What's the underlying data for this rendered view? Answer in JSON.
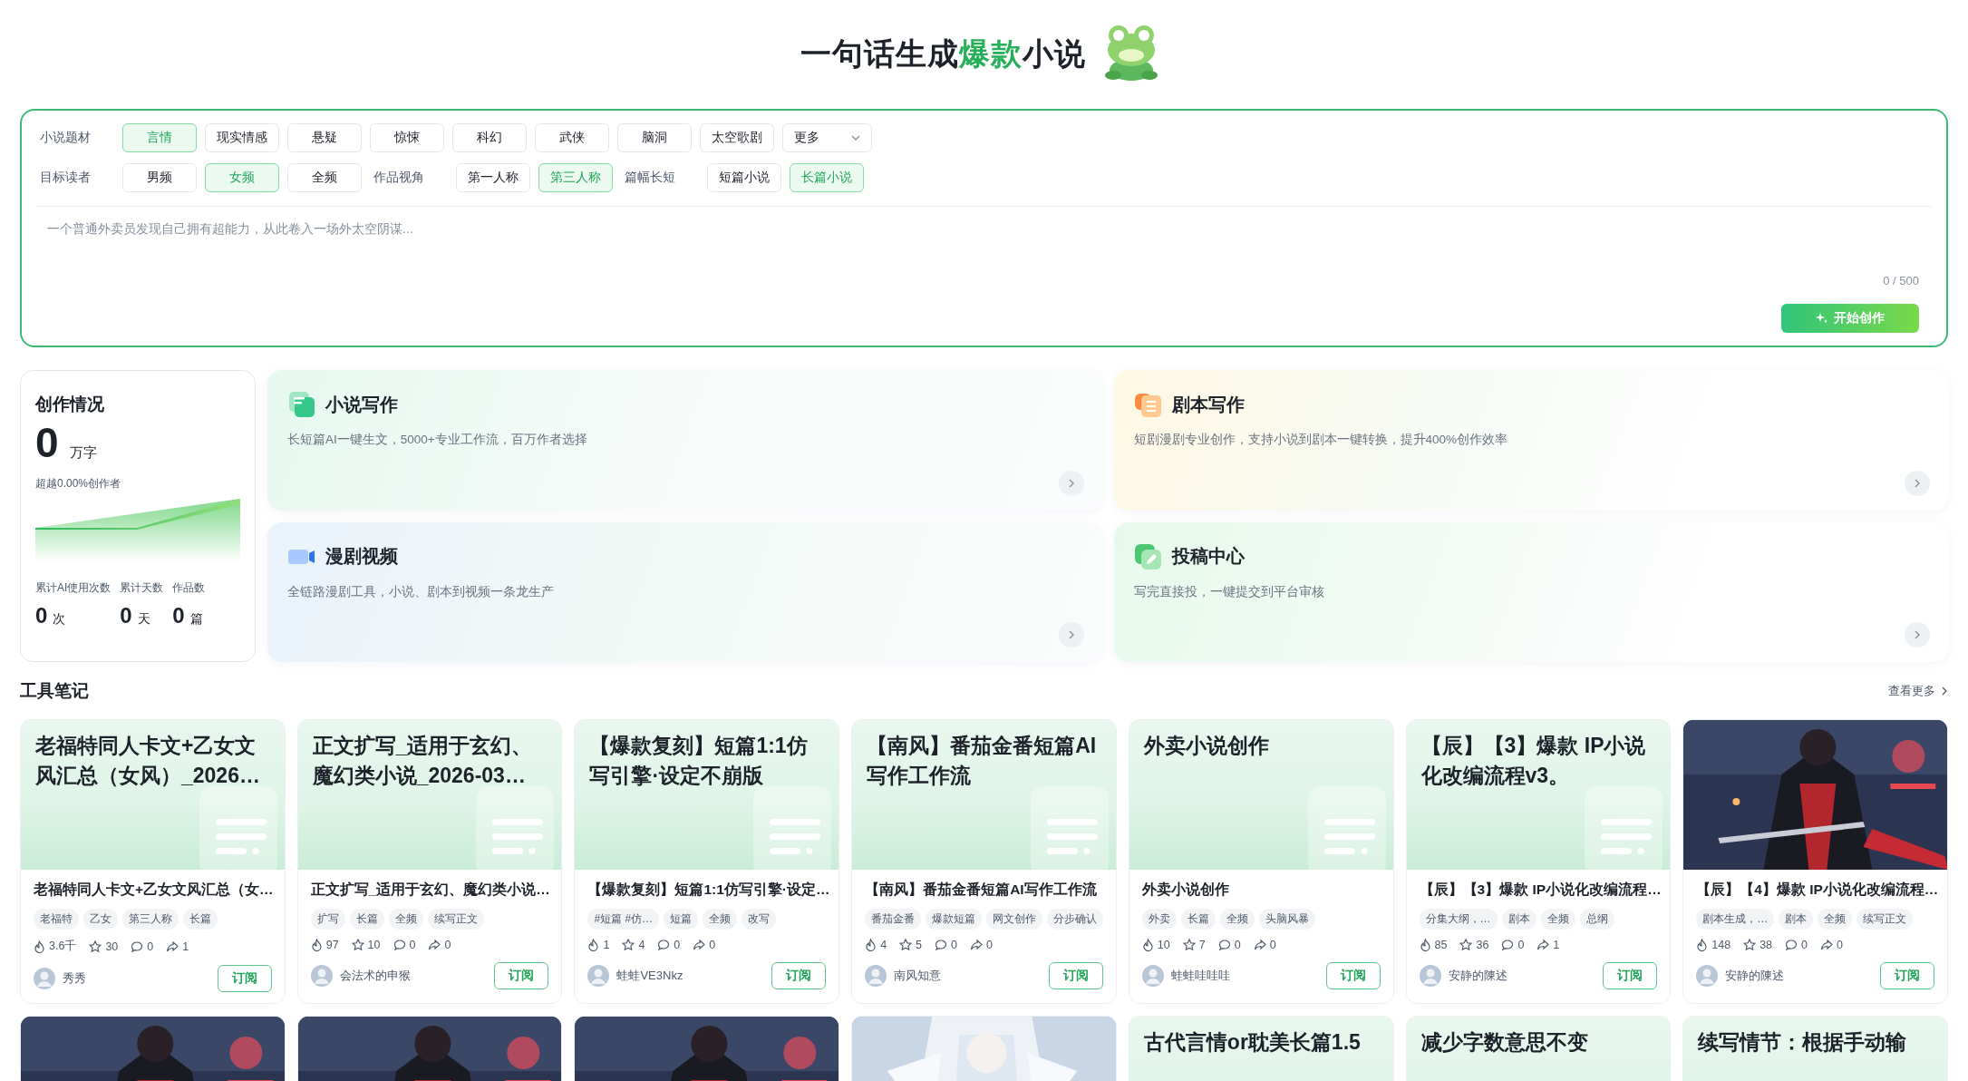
{
  "header": {
    "title_start": "一句话生成",
    "title_highlight": "爆款",
    "title_end": "小说"
  },
  "form": {
    "rows": [
      [
        {
          "kind": "label",
          "text": "小说题材"
        },
        {
          "kind": "chip",
          "text": "言情",
          "selected": true
        },
        {
          "kind": "chip",
          "text": "现实情感",
          "selected": false
        },
        {
          "kind": "chip",
          "text": "悬疑",
          "selected": false
        },
        {
          "kind": "chip",
          "text": "惊悚",
          "selected": false
        },
        {
          "kind": "chip",
          "text": "科幻",
          "selected": false
        },
        {
          "kind": "chip",
          "text": "武侠",
          "selected": false
        },
        {
          "kind": "chip",
          "text": "脑洞",
          "selected": false
        },
        {
          "kind": "chip",
          "text": "太空歌剧",
          "selected": false
        },
        {
          "kind": "select",
          "text": "更多"
        }
      ],
      [
        {
          "kind": "label",
          "text": "目标读者"
        },
        {
          "kind": "chip",
          "text": "男频",
          "selected": false
        },
        {
          "kind": "chip",
          "text": "女频",
          "selected": true
        },
        {
          "kind": "chip",
          "text": "全频",
          "selected": false
        },
        {
          "kind": "label",
          "text": "作品视角"
        },
        {
          "kind": "chip",
          "text": "第一人称",
          "selected": false
        },
        {
          "kind": "chip",
          "text": "第三人称",
          "selected": true
        },
        {
          "kind": "label",
          "text": "篇幅长短"
        },
        {
          "kind": "chip",
          "text": "短篇小说",
          "selected": false
        },
        {
          "kind": "chip",
          "text": "长篇小说",
          "selected": true
        }
      ]
    ],
    "placeholder": "一个普通外卖员发现自己拥有超能力，从此卷入一场外太空阴谋...",
    "counter": "0 / 500",
    "submit": "开始创作"
  },
  "stats": {
    "title": "创作情况",
    "total": "0",
    "total_unit": "万字",
    "rank": "超越0.00%创作者",
    "metrics": [
      {
        "label": "累计AI使用次数",
        "value": "0",
        "unit": "次"
      },
      {
        "label": "累计天数",
        "value": "0",
        "unit": "天"
      },
      {
        "label": "作品数",
        "value": "0",
        "unit": "篇"
      }
    ]
  },
  "features": [
    {
      "title": "小说写作",
      "description": "长短篇AI一键生文，5000+专业工作流，百万作者选择"
    },
    {
      "title": "剧本写作",
      "description": "短剧漫剧专业创作，支持小说到剧本一键转换，提升400%创作效率"
    },
    {
      "title": "漫剧视频",
      "description": "全链路漫剧工具，小说、剧本到视频一条龙生产"
    },
    {
      "title": "投稿中心",
      "description": "写完直接投，一键提交到平台审核"
    }
  ],
  "tools": {
    "title": "工具笔记",
    "more": "查看更多"
  },
  "notes": [
    {
      "cover": {
        "kind": "text",
        "title": "老福特同人卡文+乙女文风汇总（女风）_2026…"
      },
      "title": "老福特同人卡文+乙女文风汇总（女…",
      "tags": [
        "老福特",
        "乙女",
        "第三人称",
        "长篇"
      ],
      "heat": "3.6千",
      "stars": "30",
      "comments": "0",
      "shares": "1",
      "author": "秀秀",
      "button": "订阅"
    },
    {
      "cover": {
        "kind": "text",
        "title": "正文扩写_适用于玄幻、魔幻类小说_2026-03…"
      },
      "title": "正文扩写_适用于玄幻、魔幻类小说…",
      "tags": [
        "扩写",
        "长篇",
        "全频",
        "续写正文"
      ],
      "heat": "97",
      "stars": "10",
      "comments": "0",
      "shares": "0",
      "author": "会法术的申猴",
      "button": "订阅"
    },
    {
      "cover": {
        "kind": "text",
        "title": "【爆款复刻】短篇1:1仿写引擎·设定不崩版"
      },
      "title": "【爆款复刻】短篇1:1仿写引擎·设定…",
      "tags": [
        "#短篇 #仿…",
        "短篇",
        "全频",
        "改写"
      ],
      "heat": "1",
      "stars": "4",
      "comments": "0",
      "shares": "0",
      "author": "蛙蛙VE3Nkz",
      "button": "订阅"
    },
    {
      "cover": {
        "kind": "text",
        "title": "【南风】番茄金番短篇AI写作工作流"
      },
      "title": "【南风】番茄金番短篇AI写作工作流",
      "tags": [
        "番茄金番",
        "爆款短篇",
        "网文创作",
        "分步确认"
      ],
      "heat": "4",
      "stars": "5",
      "comments": "0",
      "shares": "0",
      "author": "南风知意",
      "button": "订阅"
    },
    {
      "cover": {
        "kind": "text",
        "title": "外卖小说创作"
      },
      "title": "外卖小说创作",
      "tags": [
        "外卖",
        "长篇",
        "全频",
        "头脑风暴"
      ],
      "heat": "10",
      "stars": "7",
      "comments": "0",
      "shares": "0",
      "author": "蛙蛙哇哇哇",
      "button": "订阅"
    },
    {
      "cover": {
        "kind": "text",
        "title": "【辰】【3】爆款 IP小说化改编流程v3。"
      },
      "title": "【辰】【3】爆款 IP小说化改编流程…",
      "tags": [
        "分集大纲，…",
        "剧本",
        "全频",
        "总纲"
      ],
      "heat": "85",
      "stars": "36",
      "comments": "0",
      "shares": "1",
      "author": "安静的陳述",
      "button": "订阅"
    },
    {
      "cover": {
        "kind": "picture"
      },
      "title": "【辰】【4】爆款 IP小说化改编流程…",
      "tags": [
        "剧本生成，…",
        "剧本",
        "全频",
        "续写正文"
      ],
      "heat": "148",
      "stars": "38",
      "comments": "0",
      "shares": "0",
      "author": "安静的陳述",
      "button": "订阅"
    },
    {
      "cover": {
        "kind": "picture"
      }
    },
    {
      "cover": {
        "kind": "picture"
      }
    },
    {
      "cover": {
        "kind": "picture"
      }
    },
    {
      "cover": {
        "kind": "picture"
      }
    },
    {
      "cover": {
        "kind": "text",
        "title": "古代言情or耽美长篇1.5"
      }
    },
    {
      "cover": {
        "kind": "text",
        "title": "减少字数意思不变"
      }
    },
    {
      "cover": {
        "kind": "text",
        "title": "续写情节：根据手动输"
      }
    }
  ]
}
